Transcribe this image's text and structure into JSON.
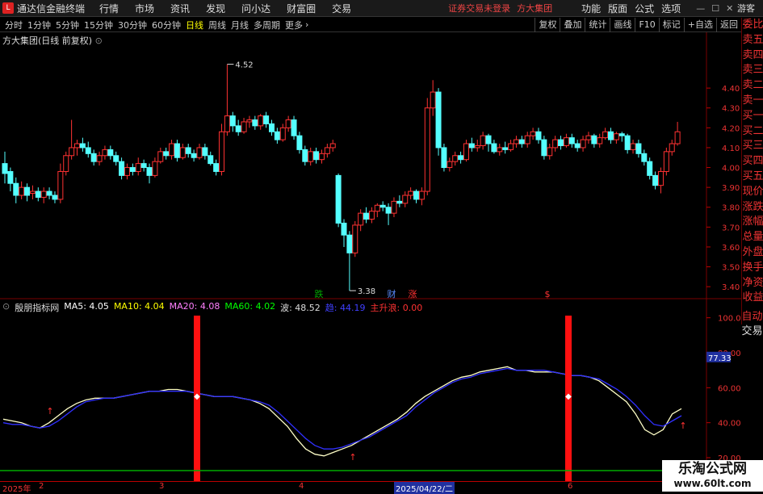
{
  "menubar": {
    "app_title": "通达信金融终端",
    "items": [
      "行情",
      "市场",
      "资讯",
      "发现",
      "问小达",
      "财富圈",
      "交易"
    ],
    "login_status": "证券交易未登录",
    "broker": "方大集团",
    "right_items": [
      "功能",
      "版面",
      "公式",
      "选项"
    ],
    "guest": "游客"
  },
  "toolbar": {
    "periods": [
      "分时",
      "1分钟",
      "5分钟",
      "15分钟",
      "30分钟",
      "60分钟",
      "日线",
      "周线",
      "月线",
      "多周期",
      "更多"
    ],
    "active_period": "日线",
    "right_tools": [
      "复权",
      "叠加",
      "统计",
      "画线",
      "F10",
      "标记",
      "+自选",
      "返回"
    ]
  },
  "chart_title": "方大集团(日线 前复权)",
  "sidebar": {
    "items": [
      "委比",
      "卖五",
      "卖四",
      "卖三",
      "卖二",
      "卖一",
      "买一",
      "买二",
      "买三",
      "买四",
      "买五",
      "现价",
      "涨跌",
      "涨幅",
      "总量",
      "外盘",
      "换手",
      "净资",
      "收益"
    ],
    "lower": [
      "自动",
      "交易"
    ]
  },
  "indicator_legend": {
    "name": "殷朋指标网",
    "ma5": "MA5: 4.05",
    "ma10": "MA10: 4.04",
    "ma20": "MA20: 4.08",
    "ma60": "MA60: 4.02",
    "wave": "波: 48.52",
    "trend": "趋: 44.19",
    "main_up": "主升浪: 0.00"
  },
  "colors": {
    "up": "#ff3232",
    "down": "#54ffff",
    "ma5": "#ffffff",
    "ma10": "#ffff00",
    "ma20": "#ff80ff",
    "ma60": "#00ff00",
    "wave_line": "#ffffc8",
    "trend_line": "#3030ff"
  },
  "chart_data": [
    {
      "type": "candlestick",
      "title": "方大集团(日线 前复权)",
      "y_ticks": [
        "4.40",
        "4.30",
        "4.20",
        "4.10",
        "4.00",
        "3.90",
        "3.80",
        "3.70",
        "3.60",
        "3.50",
        "3.40"
      ],
      "ylim": [
        3.36,
        4.62
      ],
      "annotations": [
        "4.52",
        "3.38"
      ],
      "markers": [
        "跌",
        "财",
        "涨",
        "$"
      ],
      "candles": [
        [
          4.02,
          3.97,
          4.08,
          3.92
        ],
        [
          3.98,
          3.92,
          4.0,
          3.88
        ],
        [
          3.92,
          3.86,
          3.95,
          3.82
        ],
        [
          3.86,
          3.9,
          3.93,
          3.84
        ],
        [
          3.9,
          3.86,
          3.92,
          3.83
        ],
        [
          3.87,
          3.88,
          3.91,
          3.84
        ],
        [
          3.88,
          3.85,
          3.9,
          3.83
        ],
        [
          3.85,
          3.88,
          3.9,
          3.82
        ],
        [
          3.88,
          3.86,
          3.9,
          3.84
        ],
        [
          3.86,
          3.84,
          3.88,
          3.82
        ],
        [
          3.84,
          3.98,
          4.02,
          3.82
        ],
        [
          3.98,
          4.06,
          4.08,
          3.96
        ],
        [
          4.06,
          4.1,
          4.24,
          4.04
        ],
        [
          4.1,
          4.12,
          4.14,
          4.06
        ],
        [
          4.12,
          4.1,
          4.15,
          4.08
        ],
        [
          4.1,
          4.07,
          4.13,
          4.05
        ],
        [
          4.07,
          4.03,
          4.09,
          4.01
        ],
        [
          4.03,
          4.06,
          4.08,
          4.01
        ],
        [
          4.06,
          4.09,
          4.11,
          4.04
        ],
        [
          4.09,
          4.06,
          4.11,
          4.04
        ],
        [
          4.06,
          4.03,
          4.08,
          4.01
        ],
        [
          4.03,
          3.96,
          4.05,
          3.94
        ],
        [
          3.96,
          4.0,
          4.02,
          3.94
        ],
        [
          4.0,
          3.98,
          4.02,
          3.96
        ],
        [
          3.98,
          4.02,
          4.05,
          3.96
        ],
        [
          4.02,
          4.0,
          4.04,
          3.98
        ],
        [
          4.0,
          3.96,
          4.02,
          3.92
        ],
        [
          3.96,
          4.03,
          4.05,
          3.95
        ],
        [
          4.03,
          4.08,
          4.1,
          4.02
        ],
        [
          4.08,
          4.06,
          4.1,
          4.04
        ],
        [
          4.06,
          4.12,
          4.14,
          4.04
        ],
        [
          4.12,
          4.05,
          4.14,
          4.03
        ],
        [
          4.05,
          4.1,
          4.12,
          4.04
        ],
        [
          4.1,
          4.07,
          4.12,
          4.05
        ],
        [
          4.07,
          4.05,
          4.09,
          4.03
        ],
        [
          4.05,
          4.1,
          4.12,
          4.04
        ],
        [
          4.1,
          4.06,
          4.12,
          4.04
        ],
        [
          4.06,
          4.02,
          4.08,
          4.01
        ],
        [
          4.02,
          3.98,
          4.04,
          3.96
        ],
        [
          3.98,
          4.18,
          4.22,
          3.96
        ],
        [
          4.18,
          4.26,
          4.52,
          4.16
        ],
        [
          4.26,
          4.21,
          4.28,
          4.18
        ],
        [
          4.21,
          4.18,
          4.24,
          4.16
        ],
        [
          4.18,
          4.23,
          4.25,
          4.17
        ],
        [
          4.23,
          4.24,
          4.26,
          4.2
        ],
        [
          4.24,
          4.21,
          4.26,
          4.19
        ],
        [
          4.21,
          4.26,
          4.27,
          4.19
        ],
        [
          4.26,
          4.22,
          4.28,
          4.2
        ],
        [
          4.22,
          4.18,
          4.24,
          4.16
        ],
        [
          4.18,
          4.14,
          4.2,
          4.12
        ],
        [
          4.14,
          4.2,
          4.22,
          4.13
        ],
        [
          4.2,
          4.24,
          4.26,
          4.18
        ],
        [
          4.24,
          4.16,
          4.26,
          4.14
        ],
        [
          4.16,
          4.09,
          4.18,
          4.07
        ],
        [
          4.09,
          4.03,
          4.11,
          4.01
        ],
        [
          4.03,
          4.08,
          4.1,
          4.01
        ],
        [
          4.08,
          4.04,
          4.1,
          4.02
        ],
        [
          4.04,
          4.07,
          4.09,
          4.02
        ],
        [
          4.07,
          4.1,
          4.12,
          4.05
        ],
        [
          4.1,
          4.12,
          4.14,
          4.08
        ],
        [
          3.96,
          3.72,
          3.97,
          3.7
        ],
        [
          3.72,
          3.66,
          3.74,
          3.6
        ],
        [
          3.66,
          3.57,
          3.68,
          3.38
        ],
        [
          3.57,
          3.71,
          3.73,
          3.55
        ],
        [
          3.71,
          3.77,
          3.79,
          3.68
        ],
        [
          3.77,
          3.74,
          3.8,
          3.72
        ],
        [
          3.74,
          3.78,
          3.8,
          3.72
        ],
        [
          3.78,
          3.81,
          3.82,
          3.75
        ],
        [
          3.81,
          3.8,
          3.83,
          3.78
        ],
        [
          3.8,
          3.77,
          3.82,
          3.71
        ],
        [
          3.77,
          3.83,
          3.85,
          3.75
        ],
        [
          3.83,
          3.82,
          3.86,
          3.8
        ],
        [
          3.82,
          3.86,
          3.88,
          3.8
        ],
        [
          3.86,
          3.88,
          3.9,
          3.84
        ],
        [
          3.88,
          3.84,
          3.89,
          3.82
        ],
        [
          3.84,
          3.88,
          3.9,
          3.81
        ],
        [
          3.88,
          4.3,
          4.35,
          3.86
        ],
        [
          4.3,
          4.38,
          4.44,
          4.26
        ],
        [
          4.38,
          4.1,
          4.4,
          4.06
        ],
        [
          4.1,
          4.0,
          4.12,
          3.98
        ],
        [
          4.0,
          4.03,
          4.05,
          3.98
        ],
        [
          4.03,
          4.06,
          4.08,
          4.01
        ],
        [
          4.06,
          4.04,
          4.08,
          4.02
        ],
        [
          4.04,
          4.12,
          4.14,
          4.03
        ],
        [
          4.12,
          4.1,
          4.15,
          4.08
        ],
        [
          4.1,
          4.11,
          4.14,
          4.08
        ],
        [
          4.11,
          4.16,
          4.18,
          4.09
        ],
        [
          4.16,
          4.12,
          4.17,
          4.08
        ],
        [
          4.12,
          4.08,
          4.14,
          4.07
        ],
        [
          4.08,
          4.1,
          4.12,
          4.06
        ],
        [
          4.1,
          4.09,
          4.13,
          4.07
        ],
        [
          4.09,
          4.12,
          4.14,
          4.08
        ],
        [
          4.12,
          4.14,
          4.16,
          4.1
        ],
        [
          4.14,
          4.12,
          4.16,
          4.1
        ],
        [
          4.12,
          4.16,
          4.18,
          4.1
        ],
        [
          4.16,
          4.18,
          4.2,
          4.14
        ],
        [
          4.18,
          4.14,
          4.2,
          4.12
        ],
        [
          4.14,
          4.06,
          4.16,
          4.04
        ],
        [
          4.06,
          4.1,
          4.12,
          4.04
        ],
        [
          4.1,
          4.14,
          4.16,
          4.08
        ],
        [
          4.14,
          4.11,
          4.16,
          4.09
        ],
        [
          4.11,
          4.15,
          4.17,
          4.1
        ],
        [
          4.15,
          4.12,
          4.17,
          4.1
        ],
        [
          4.12,
          4.1,
          4.14,
          4.08
        ],
        [
          4.1,
          4.14,
          4.16,
          4.08
        ],
        [
          4.14,
          4.16,
          4.18,
          4.12
        ],
        [
          4.16,
          4.12,
          4.17,
          4.1
        ],
        [
          4.12,
          4.15,
          4.17,
          4.1
        ],
        [
          4.15,
          4.18,
          4.2,
          4.14
        ],
        [
          4.18,
          4.14,
          4.2,
          4.12
        ],
        [
          4.14,
          4.17,
          4.18,
          4.12
        ],
        [
          4.17,
          4.16,
          4.18,
          4.13
        ],
        [
          4.16,
          4.09,
          4.17,
          4.07
        ],
        [
          4.09,
          4.12,
          4.14,
          4.07
        ],
        [
          4.12,
          4.07,
          4.14,
          4.05
        ],
        [
          4.07,
          4.03,
          4.09,
          4.01
        ],
        [
          4.03,
          3.96,
          4.05,
          3.94
        ],
        [
          3.96,
          3.91,
          3.98,
          3.89
        ],
        [
          3.91,
          3.98,
          4.0,
          3.87
        ],
        [
          3.98,
          4.08,
          4.1,
          3.96
        ],
        [
          4.08,
          4.12,
          4.14,
          4.06
        ],
        [
          4.12,
          4.18,
          4.23,
          4.11
        ]
      ]
    },
    {
      "type": "line",
      "y_ticks": [
        "100.0",
        "80.00",
        "60.00",
        "40.00",
        "20.00"
      ],
      "ylim": [
        14,
        104
      ],
      "current_value": "77.33",
      "series": [
        {
          "name": "波",
          "values": [
            42,
            41,
            40,
            38,
            37,
            40,
            44,
            48,
            51,
            53,
            54,
            54,
            54,
            55,
            56,
            57,
            58,
            58,
            59,
            59,
            58,
            57,
            56,
            55,
            55,
            55,
            54,
            53,
            51,
            48,
            43,
            38,
            31,
            25,
            22,
            21,
            23,
            25,
            27,
            30,
            33,
            36,
            39,
            42,
            46,
            51,
            55,
            58,
            61,
            64,
            66,
            67,
            69,
            70,
            71,
            72,
            70,
            70,
            69,
            69,
            69,
            68,
            67,
            67,
            66,
            64,
            60,
            56,
            52,
            45,
            36,
            33,
            36,
            45,
            48
          ]
        },
        {
          "name": "趋",
          "values": [
            40,
            39,
            39,
            38,
            37,
            38,
            41,
            45,
            49,
            52,
            53,
            54,
            54,
            55,
            56,
            57,
            58,
            58,
            58,
            58,
            58,
            57,
            56,
            55,
            55,
            55,
            54,
            53,
            52,
            50,
            46,
            41,
            36,
            31,
            27,
            25,
            25,
            26,
            28,
            30,
            32,
            35,
            38,
            41,
            44,
            49,
            53,
            57,
            60,
            63,
            65,
            66,
            68,
            69,
            70,
            71,
            70,
            70,
            70,
            70,
            69,
            68,
            67,
            67,
            66,
            65,
            62,
            59,
            55,
            50,
            44,
            39,
            38,
            41,
            44
          ]
        }
      ],
      "signal_bars": [
        "0.00",
        "0.00"
      ]
    }
  ],
  "x_axis": {
    "labels": [
      "2025年",
      "2",
      "3",
      "4",
      "2025/04/22/二",
      "6"
    ]
  },
  "watermark": {
    "title": "乐淘公式网",
    "url": "www.60lt.com"
  }
}
